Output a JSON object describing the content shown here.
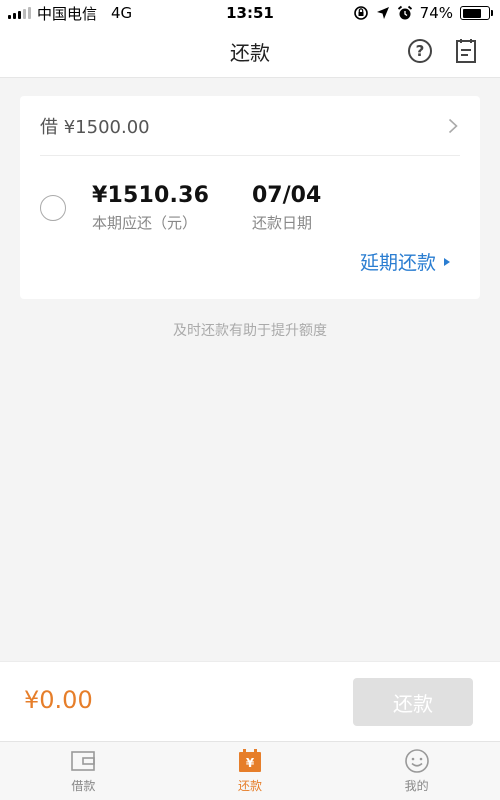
{
  "status_bar": {
    "carrier": "中国电信",
    "network": "4G",
    "time": "13:51",
    "battery": "74%"
  },
  "nav": {
    "title": "还款",
    "help_icon": "question-circle-icon",
    "notes_icon": "notepad-icon"
  },
  "loan": {
    "principal": "借 ¥1500.00",
    "amount_due": "¥1510.36",
    "amount_due_label": "本期应还（元）",
    "due_date": "07/04",
    "due_date_label": "还款日期",
    "extend_link": "延期还款"
  },
  "tip": "及时还款有助于提升额度",
  "action": {
    "total": "¥0.00",
    "repay_button": "还款"
  },
  "tabs": [
    {
      "label": "借款",
      "icon": "wallet-icon",
      "active": false
    },
    {
      "label": "还款",
      "icon": "yen-calendar-icon",
      "active": true
    },
    {
      "label": "我的",
      "icon": "smiley-icon",
      "active": false
    }
  ],
  "colors": {
    "accent": "#e67e2a",
    "link": "#2a7dd1",
    "background": "#f4f4f4"
  }
}
